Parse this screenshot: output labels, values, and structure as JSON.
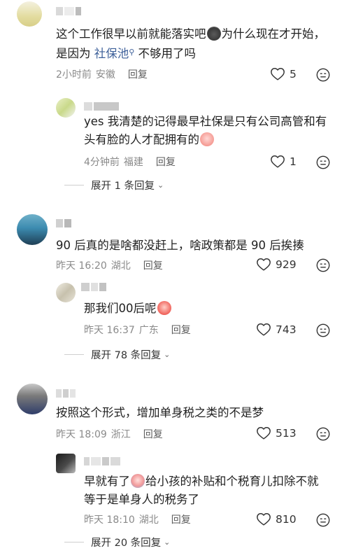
{
  "comments": [
    {
      "text_before": "这个工作很早以前就能落实吧",
      "text_mid": "为什么现在才开始，是因为 ",
      "link": "社保池",
      "text_after": " 不够用了吗",
      "time": "2小时前",
      "location": "安徽",
      "reply_label": "回复",
      "likes": "5",
      "reply": {
        "text": "yes 我清楚的记得最早社保是只有公司高管和有头有脸的人才配拥有的",
        "time": "4分钟前",
        "location": "福建",
        "reply_label": "回复",
        "likes": "1"
      },
      "expand_label": "展开 1 条回复"
    },
    {
      "text": "90 后真的是啥都没赶上，啥政策都是 90 后挨揍",
      "time": "昨天 16:20",
      "location": "湖北",
      "reply_label": "回复",
      "likes": "929",
      "reply": {
        "text": "那我们00后呢",
        "time": "昨天 16:37",
        "location": "广东",
        "reply_label": "回复",
        "likes": "743"
      },
      "expand_label": "展开 78 条回复"
    },
    {
      "text": "按照这个形式，增加单身税之类的不是梦",
      "time": "昨天 18:09",
      "location": "浙江",
      "reply_label": "回复",
      "likes": "513",
      "reply": {
        "text_before": "早就有了",
        "text_after": "给小孩的补贴和个税育儿扣除不就等于是单身人的税务了",
        "time": "昨天 18:10",
        "location": "湖北",
        "reply_label": "回复",
        "likes": "810"
      },
      "expand_label": "展开 20 条回复"
    }
  ],
  "colors": {
    "link": "#3c5f99",
    "meta": "#8a8a8a",
    "text": "#1f1f1f"
  }
}
